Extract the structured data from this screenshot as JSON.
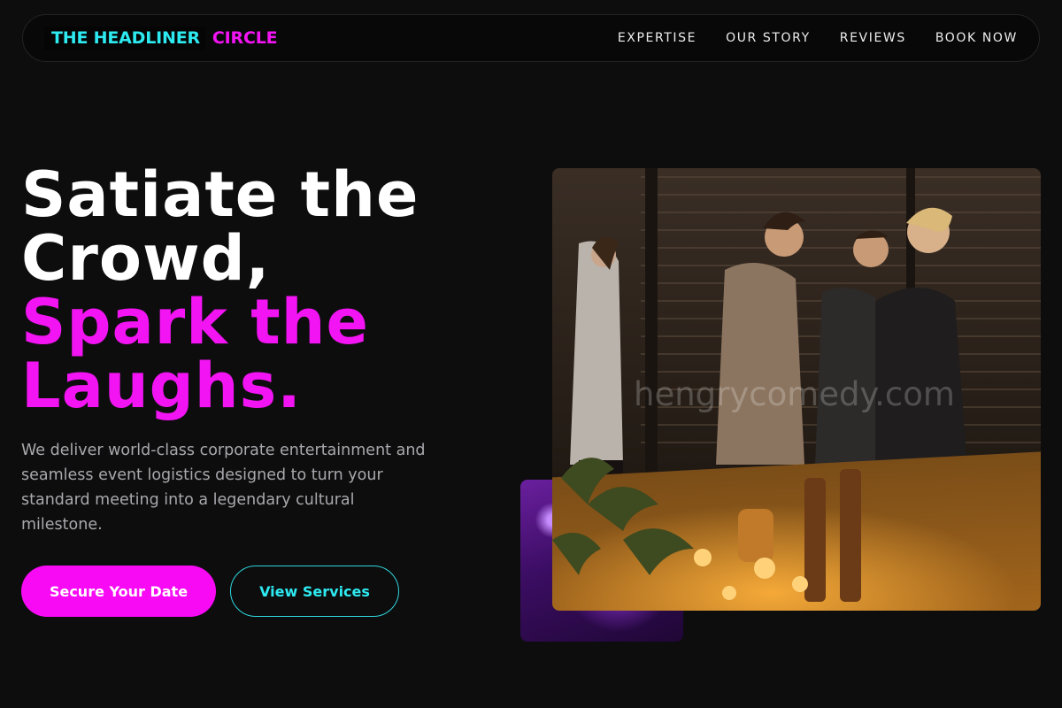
{
  "brand": {
    "part1": "THE HEADLINER",
    "part2": "CIRCLE",
    "accent_cyan": "#2de9f0",
    "accent_magenta": "#f314f3"
  },
  "nav": {
    "items": [
      "EXPERTISE",
      "OUR STORY",
      "REVIEWS",
      "BOOK NOW"
    ]
  },
  "hero": {
    "line1": "Satiate the",
    "line2": "Crowd,",
    "line3": "Spark the",
    "line4": "Laughs.",
    "description": "We deliver world-class corporate entertainment and seamless event logistics designed to turn your standard meeting into a legendary cultural milestone.",
    "primary_cta": "Secure Your Date",
    "secondary_cta": "View Services"
  },
  "media": {
    "watermark": "hengrycomedy.com"
  }
}
